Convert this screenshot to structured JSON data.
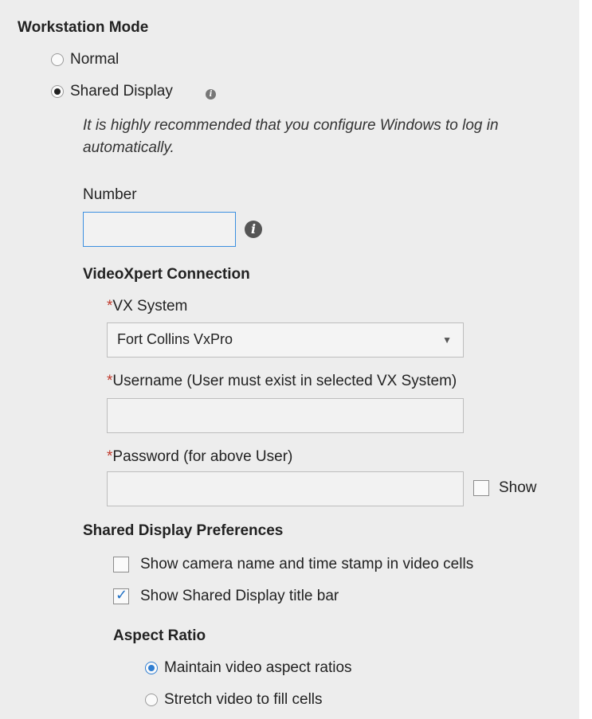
{
  "workstation_mode": {
    "heading": "Workstation Mode",
    "options": [
      "Normal",
      "Shared Display"
    ],
    "selected": "Shared Display",
    "info_icon": "info-icon",
    "notice": "It is highly recommended that you configure Windows to log in automatically."
  },
  "number": {
    "label": "Number",
    "value": "",
    "info_icon": "info-icon"
  },
  "videoxpert": {
    "heading": "VideoXpert Connection",
    "required_mark": "*",
    "vx_system_label": "VX System",
    "vx_system_value": "Fort Collins VxPro",
    "dropdown_caret": "▼",
    "username_label": "Username (User must exist in selected VX System)",
    "username_value": "",
    "password_label": "Password (for above User)",
    "password_value": "",
    "show_label": "Show",
    "show_checked": false
  },
  "preferences": {
    "heading": "Shared Display Preferences",
    "show_camera_name_label": "Show camera name and time stamp in video cells",
    "show_camera_name_checked": false,
    "show_title_bar_label": "Show Shared Display title bar",
    "show_title_bar_checked": true,
    "check_glyph": "✓"
  },
  "aspect_ratio": {
    "heading": "Aspect Ratio",
    "options": [
      "Maintain video aspect ratios",
      "Stretch video to fill cells"
    ],
    "selected": "Maintain video aspect ratios"
  },
  "colors": {
    "panel_bg": "#ededed",
    "required": "#c0392b",
    "accent": "#2e7dd1"
  }
}
